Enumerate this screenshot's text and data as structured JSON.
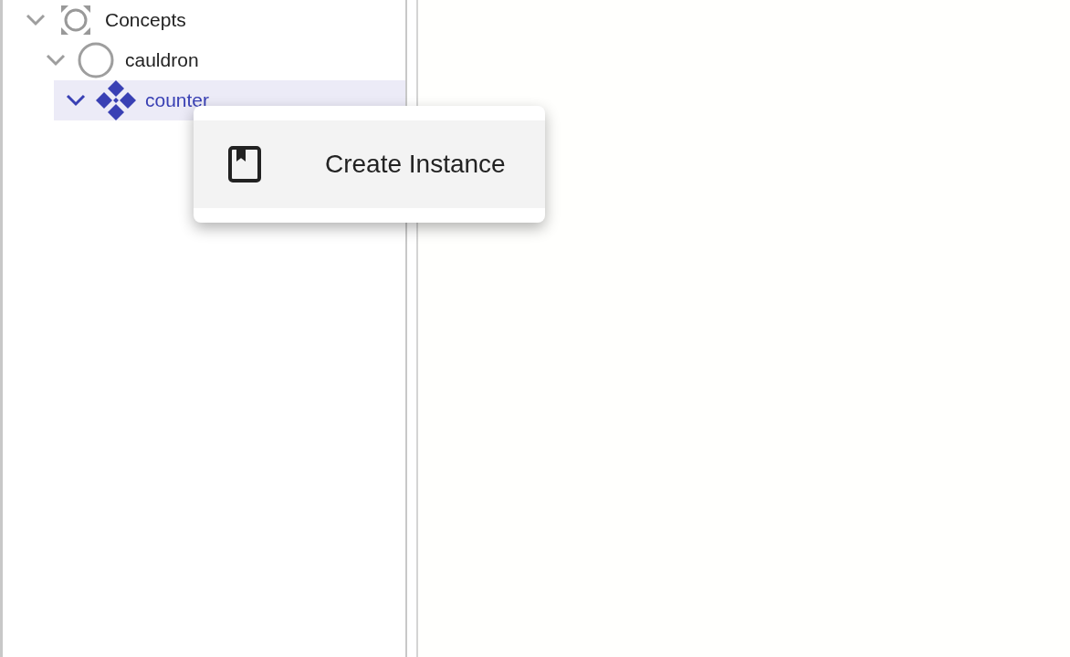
{
  "tree": [
    {
      "label": "Concepts",
      "kind": "root",
      "expanded": true,
      "selected": false,
      "children": [
        {
          "label": "cauldron",
          "kind": "package",
          "expanded": true,
          "selected": false,
          "children": [
            {
              "label": "counter",
              "kind": "concept",
              "expanded": true,
              "selected": true
            }
          ]
        }
      ]
    }
  ],
  "context_menu": {
    "items": [
      {
        "label": "Create Instance",
        "selected": true
      }
    ]
  }
}
